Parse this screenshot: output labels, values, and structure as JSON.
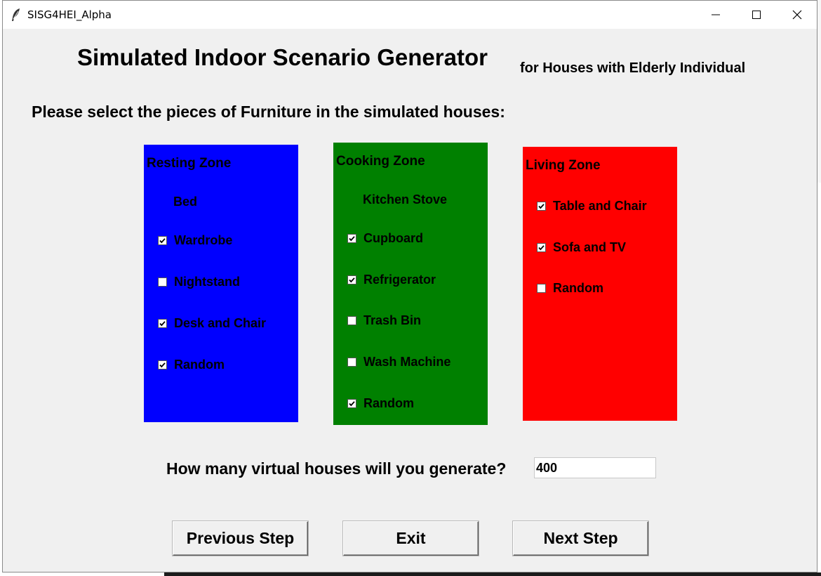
{
  "window": {
    "title": "SISG4HEI_Alpha"
  },
  "header": {
    "title": "Simulated Indoor Scenario Generator",
    "subtitle": "for Houses with Elderly Individual",
    "instruction": "Please select the pieces of Furniture in the simulated houses:"
  },
  "zones": {
    "resting": {
      "color": "#0000ff",
      "title": "Resting Zone",
      "fixed": "Bed",
      "items": [
        {
          "label": "Wardrobe",
          "checked": true
        },
        {
          "label": "Nightstand",
          "checked": false
        },
        {
          "label": "Desk and Chair",
          "checked": true
        },
        {
          "label": "Random",
          "checked": true
        }
      ]
    },
    "cooking": {
      "color": "#008000",
      "title": "Cooking Zone",
      "fixed": "Kitchen Stove",
      "items": [
        {
          "label": "Cupboard",
          "checked": true
        },
        {
          "label": "Refrigerator",
          "checked": true
        },
        {
          "label": "Trash Bin",
          "checked": false
        },
        {
          "label": "Wash Machine",
          "checked": false
        },
        {
          "label": "Random",
          "checked": true
        }
      ]
    },
    "living": {
      "color": "#ff0000",
      "title": "Living Zone",
      "items": [
        {
          "label": "Table and Chair",
          "checked": true
        },
        {
          "label": "Sofa and TV",
          "checked": true
        },
        {
          "label": "Random",
          "checked": false
        }
      ]
    }
  },
  "houses": {
    "question": "How many virtual houses will you generate?",
    "value": "400"
  },
  "actions": {
    "previous": "Previous Step",
    "exit": "Exit",
    "next": "Next Step"
  },
  "icons": {
    "app": "feather-icon",
    "minimize": "minimize-icon",
    "maximize": "maximize-icon",
    "close": "close-icon",
    "checkmark": "checkmark-icon"
  }
}
